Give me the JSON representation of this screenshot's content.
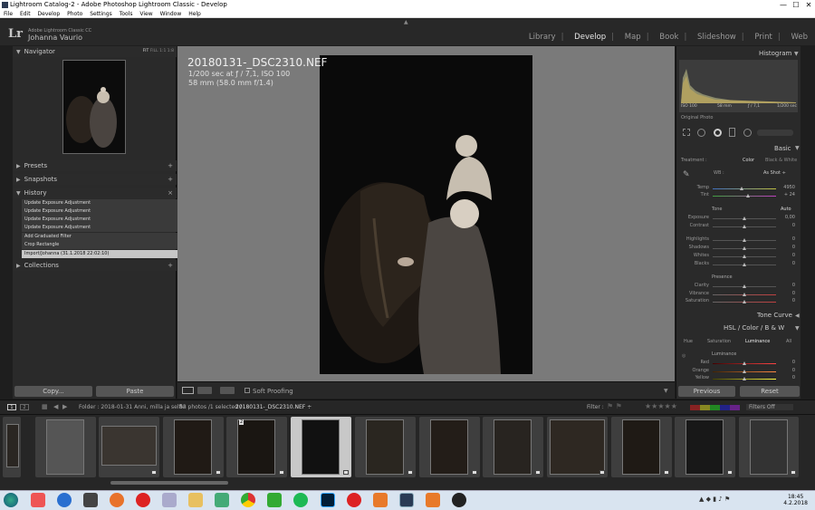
{
  "window": {
    "title": "Lightroom Catalog-2 - Adobe Photoshop Lightroom Classic - Develop",
    "buttons": [
      "—",
      "☐",
      "✕"
    ]
  },
  "menu": [
    "File",
    "Edit",
    "Develop",
    "Photo",
    "Settings",
    "Tools",
    "View",
    "Window",
    "Help"
  ],
  "branding": {
    "logo": "Lr",
    "product": "Adobe Lightroom Classic CC",
    "user": "Johanna Vaurio"
  },
  "modules": [
    {
      "label": "Library",
      "active": false
    },
    {
      "label": "Develop",
      "active": true
    },
    {
      "label": "Map",
      "active": false
    },
    {
      "label": "Book",
      "active": false
    },
    {
      "label": "Slideshow",
      "active": false
    },
    {
      "label": "Print",
      "active": false
    },
    {
      "label": "Web",
      "active": false
    }
  ],
  "left": {
    "navigator": {
      "title": "Navigator",
      "zoom": [
        "FIT",
        "FILL",
        "1:1",
        "1:8"
      ]
    },
    "presets": "Presets",
    "snapshots": "Snapshots",
    "history": "History",
    "collections": "Collections",
    "history_items": [
      "Update Exposure Adjustment",
      "Update Exposure Adjustment",
      "Update Exposure Adjustment",
      "Update Exposure Adjustment",
      "Add Graduated Filter",
      "Crop Rectangle",
      "Import/Johanna (31.1.2018 22:02:10)"
    ],
    "copy": "Copy...",
    "paste": "Paste"
  },
  "photo": {
    "filename": "20180131-_DSC2310.NEF",
    "exposure": "1/200 sec at ƒ / 7,1, ISO 100",
    "lens": "58 mm (58.0 mm f/1.4)"
  },
  "toolbar": {
    "softproof": "Soft Proofing"
  },
  "right": {
    "histogram": {
      "title": "Histogram",
      "iso": "ISO 100",
      "focal": "58 mm",
      "aperture": "ƒ / 7,1",
      "shutter": "1/200 sec",
      "original": "Original Photo"
    },
    "basic": {
      "title": "Basic",
      "treatment": "Treatment :",
      "color": "Color",
      "bw": "Black & White",
      "wb": "WB :",
      "wb_value": "As Shot ÷",
      "tone": "Tone",
      "auto": "Auto",
      "presence": "Presence",
      "sliders": [
        {
          "label": "Temp",
          "value": "4950",
          "pos": 0.45
        },
        {
          "label": "Tint",
          "value": "+ 24",
          "pos": 0.55
        },
        {
          "label": "Exposure",
          "value": "0,00",
          "pos": 0.5
        },
        {
          "label": "Contrast",
          "value": "0",
          "pos": 0.5
        },
        {
          "label": "Highlights",
          "value": "0",
          "pos": 0.5
        },
        {
          "label": "Shadows",
          "value": "0",
          "pos": 0.5
        },
        {
          "label": "Whites",
          "value": "0",
          "pos": 0.5
        },
        {
          "label": "Blacks",
          "value": "0",
          "pos": 0.5
        },
        {
          "label": "Clarity",
          "value": "0",
          "pos": 0.5
        },
        {
          "label": "Vibrance",
          "value": "0",
          "pos": 0.5
        },
        {
          "label": "Saturation",
          "value": "0",
          "pos": 0.5
        }
      ]
    },
    "tonecurve": "Tone Curve",
    "hsl": {
      "title": "HSL / Color / B & W",
      "tabs": [
        "Hue",
        "Saturation",
        "Luminance",
        "All"
      ],
      "active": "Luminance",
      "group": "Luminance",
      "sliders": [
        {
          "label": "Red",
          "value": "0",
          "pos": 0.5
        },
        {
          "label": "Orange",
          "value": "0",
          "pos": 0.5
        },
        {
          "label": "Yellow",
          "value": "0",
          "pos": 0.5
        }
      ]
    },
    "previous": "Previous",
    "reset": "Reset"
  },
  "filmbar": {
    "pages": [
      "1",
      "2"
    ],
    "folder": "Folder : 2018-01-31 Anni, milla ja selfie",
    "count": "83 photos /1 selected /",
    "selected_file": "20180131-_DSC2310.NEF ÷",
    "filter": "Filter :",
    "filters_off": "Filters Off"
  },
  "filmstrip": {
    "selected_index": 5,
    "badge": "2"
  },
  "taskbar": {
    "time": "18:45",
    "date": "4.2.2018"
  }
}
